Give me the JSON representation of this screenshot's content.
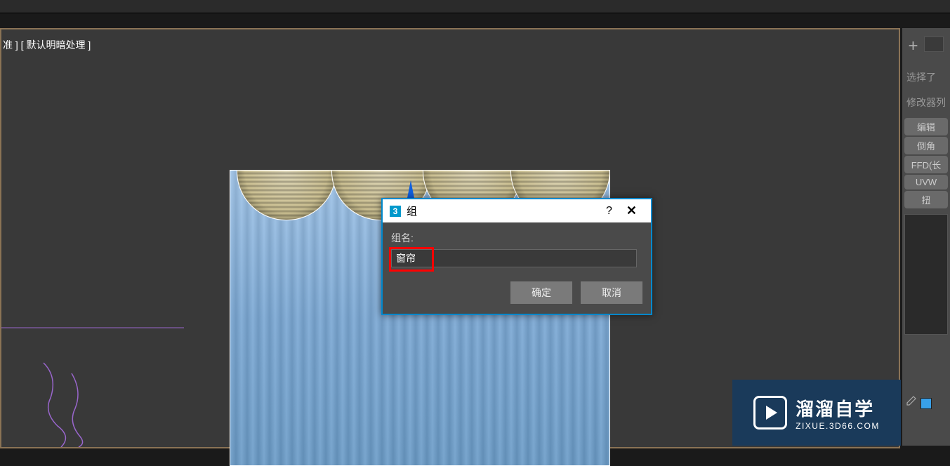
{
  "viewport": {
    "label": "准 ] [ 默认明暗处理 ]"
  },
  "dialog": {
    "icon": "3",
    "title": "组",
    "label": "组名:",
    "value": "窗帘",
    "ok": "确定",
    "cancel": "取消"
  },
  "cmd": {
    "selection": "选择了",
    "modlist_label": "修改器列",
    "mods": [
      "编辑",
      "倒角",
      "FFD(长",
      "UVW",
      "扭"
    ]
  },
  "watermark": {
    "cn": "溜溜自学",
    "url": "ZIXUE.3D66.COM"
  }
}
